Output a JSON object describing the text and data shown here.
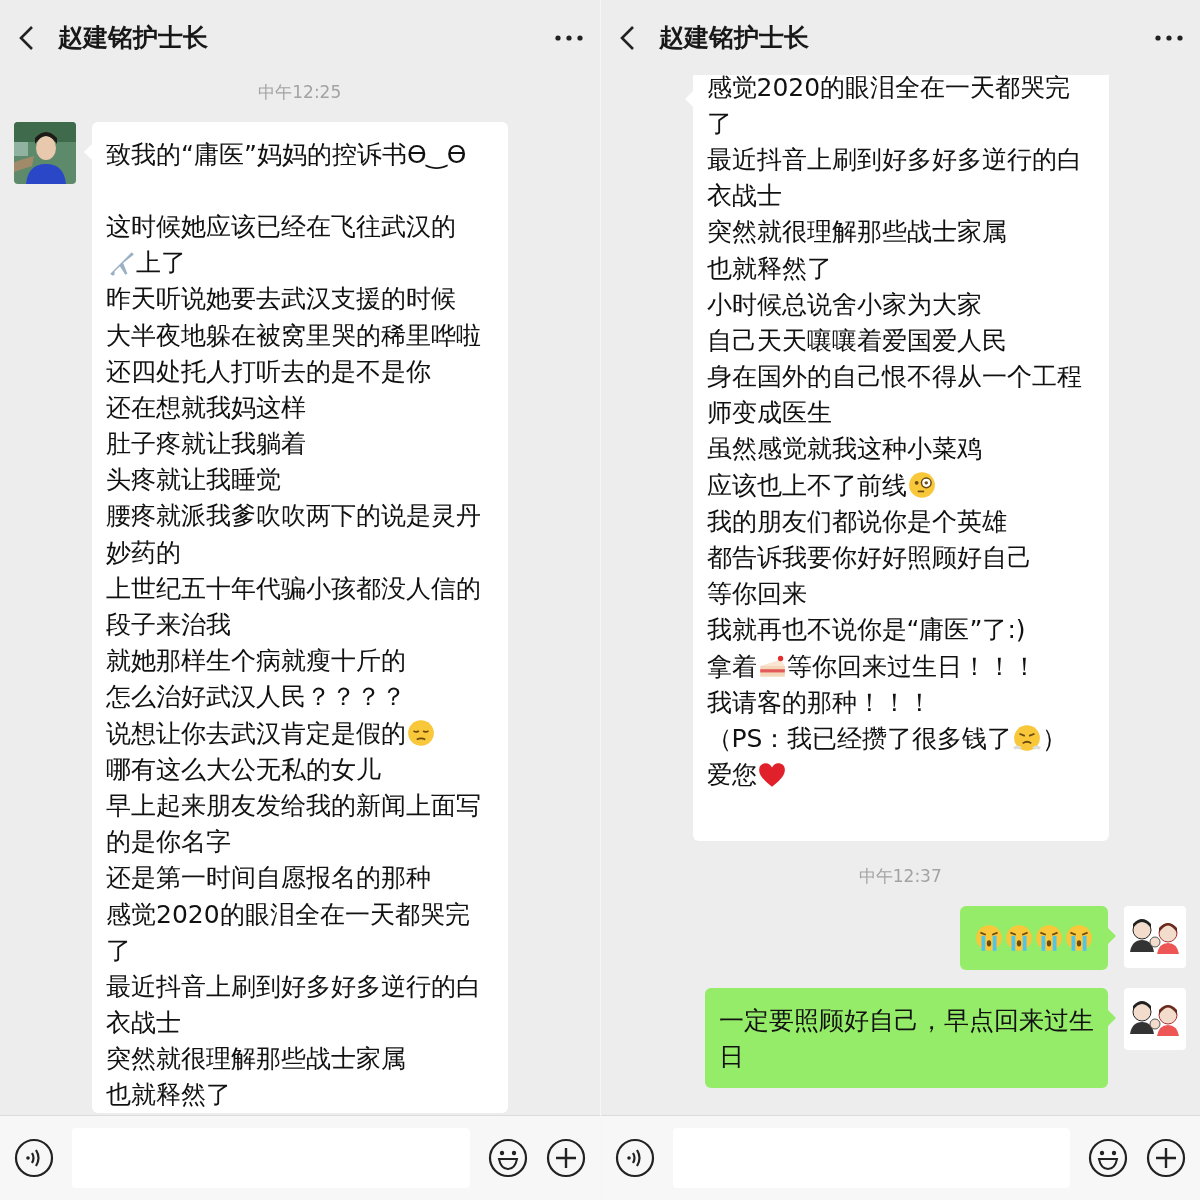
{
  "panels": [
    {
      "title": "赵建铭护士长",
      "messages": [
        {
          "kind": "timestamp",
          "text": "中午12:25"
        },
        {
          "kind": "received",
          "lines": [
            {
              "parts": [
                {
                  "text": "致我的“庸医”妈妈的控诉书Ө‿Ө"
                }
              ]
            },
            {
              "gap_before": true,
              "parts": [
                {
                  "text": "这时候她应该已经在飞往武汉的"
                }
              ]
            },
            {
              "parts": [
                {
                  "kind": "plane"
                },
                {
                  "text": "上了"
                }
              ]
            },
            {
              "parts": [
                {
                  "text": "昨天听说她要去武汉支援的时候"
                }
              ]
            },
            {
              "parts": [
                {
                  "text": "大半夜地躲在被窝里哭的稀里哗啦"
                }
              ]
            },
            {
              "parts": [
                {
                  "text": "还四处托人打听去的是不是你"
                }
              ]
            },
            {
              "parts": [
                {
                  "text": "还在想就我妈这样"
                }
              ]
            },
            {
              "parts": [
                {
                  "text": "肚子疼就让我躺着"
                }
              ]
            },
            {
              "parts": [
                {
                  "text": "头疼就让我睡觉"
                }
              ]
            },
            {
              "parts": [
                {
                  "text": "腰疼就派我爹吹吹两下的说是灵丹"
                }
              ]
            },
            {
              "parts": [
                {
                  "text": "妙药的"
                }
              ]
            },
            {
              "parts": [
                {
                  "text": "上世纪五十年代骗小孩都没人信的"
                }
              ]
            },
            {
              "parts": [
                {
                  "text": "段子来治我"
                }
              ]
            },
            {
              "parts": [
                {
                  "text": "就她那样生个病就瘦十斤的"
                }
              ]
            },
            {
              "parts": [
                {
                  "text": "怎么治好武汉人民？？？？"
                }
              ]
            },
            {
              "parts": [
                {
                  "text": "说想让你去武汉肯定是假的"
                },
                {
                  "kind": "pensive"
                }
              ]
            },
            {
              "parts": [
                {
                  "text": "哪有这么大公无私的女儿"
                }
              ]
            },
            {
              "parts": [
                {
                  "text": "早上起来朋友发给我的新闻上面写"
                }
              ]
            },
            {
              "parts": [
                {
                  "text": "的是你名字"
                }
              ]
            },
            {
              "parts": [
                {
                  "text": "还是第一时间自愿报名的那种"
                }
              ]
            },
            {
              "parts": [
                {
                  "text": "感觉2020的眼泪全在一天都哭完"
                }
              ]
            },
            {
              "parts": [
                {
                  "text": "了"
                }
              ]
            },
            {
              "parts": [
                {
                  "text": "最近抖音上刷到好多好多逆行的白"
                }
              ]
            },
            {
              "parts": [
                {
                  "text": "衣战士"
                }
              ]
            },
            {
              "parts": [
                {
                  "text": "突然就很理解那些战士家属"
                }
              ]
            },
            {
              "parts": [
                {
                  "text": "也就释然了"
                }
              ]
            }
          ]
        }
      ]
    },
    {
      "title": "赵建铭护士长",
      "messages": [
        {
          "kind": "received",
          "lines": [
            {
              "parts": [
                {
                  "text": "感觉2020的眼泪全在一天都哭完"
                }
              ]
            },
            {
              "parts": [
                {
                  "text": "了"
                }
              ]
            },
            {
              "parts": [
                {
                  "text": "最近抖音上刷到好多好多逆行的白"
                }
              ]
            },
            {
              "parts": [
                {
                  "text": "衣战士"
                }
              ]
            },
            {
              "parts": [
                {
                  "text": "突然就很理解那些战士家属"
                }
              ]
            },
            {
              "parts": [
                {
                  "text": "也就释然了"
                }
              ]
            },
            {
              "parts": [
                {
                  "text": "小时候总说舍小家为大家"
                }
              ]
            },
            {
              "parts": [
                {
                  "text": "自己天天嚷嚷着爱国爱人民"
                }
              ]
            },
            {
              "parts": [
                {
                  "text": "身在国外的自己恨不得从一个工程"
                }
              ]
            },
            {
              "parts": [
                {
                  "text": "师变成医生"
                }
              ]
            },
            {
              "parts": [
                {
                  "text": "虽然感觉就我这种小菜鸡"
                }
              ]
            },
            {
              "parts": [
                {
                  "text": "应该也上不了前线"
                },
                {
                  "kind": "monocle"
                }
              ]
            },
            {
              "parts": [
                {
                  "text": "我的朋友们都说你是个英雄"
                }
              ]
            },
            {
              "parts": [
                {
                  "text": "都告诉我要你好好照顾好自己"
                }
              ]
            },
            {
              "parts": [
                {
                  "text": "等你回来"
                }
              ]
            },
            {
              "parts": [
                {
                  "text": "我就再也不说你是“庸医”了:)"
                }
              ]
            },
            {
              "parts": [
                {
                  "text": "拿着"
                },
                {
                  "kind": "cake"
                },
                {
                  "text": "等你回来过生日！！！"
                }
              ]
            },
            {
              "parts": [
                {
                  "text": "我请客的那种！！！"
                }
              ]
            },
            {
              "parts": [
                {
                  "text": "（PS：我已经攒了很多钱了"
                },
                {
                  "kind": "steam"
                },
                {
                  "text": "）"
                }
              ]
            },
            {
              "parts": [
                {
                  "text": "爱您"
                },
                {
                  "kind": "heart"
                }
              ]
            }
          ]
        },
        {
          "kind": "timestamp",
          "text": "中午12:37"
        },
        {
          "kind": "sent",
          "avatar": {
            "kind": "drawing"
          },
          "lines": [
            {
              "parts": [
                {
                  "kind": "crying"
                },
                {
                  "kind": "crying"
                },
                {
                  "kind": "crying"
                },
                {
                  "kind": "crying"
                }
              ]
            }
          ]
        },
        {
          "kind": "sent",
          "avatar": {
            "kind": "drawing"
          },
          "lines": [
            {
              "parts": [
                {
                  "text": "一定要照顾好自己，早点回来过生"
                }
              ]
            },
            {
              "parts": [
                {
                  "text": "日"
                }
              ]
            }
          ]
        }
      ]
    }
  ]
}
